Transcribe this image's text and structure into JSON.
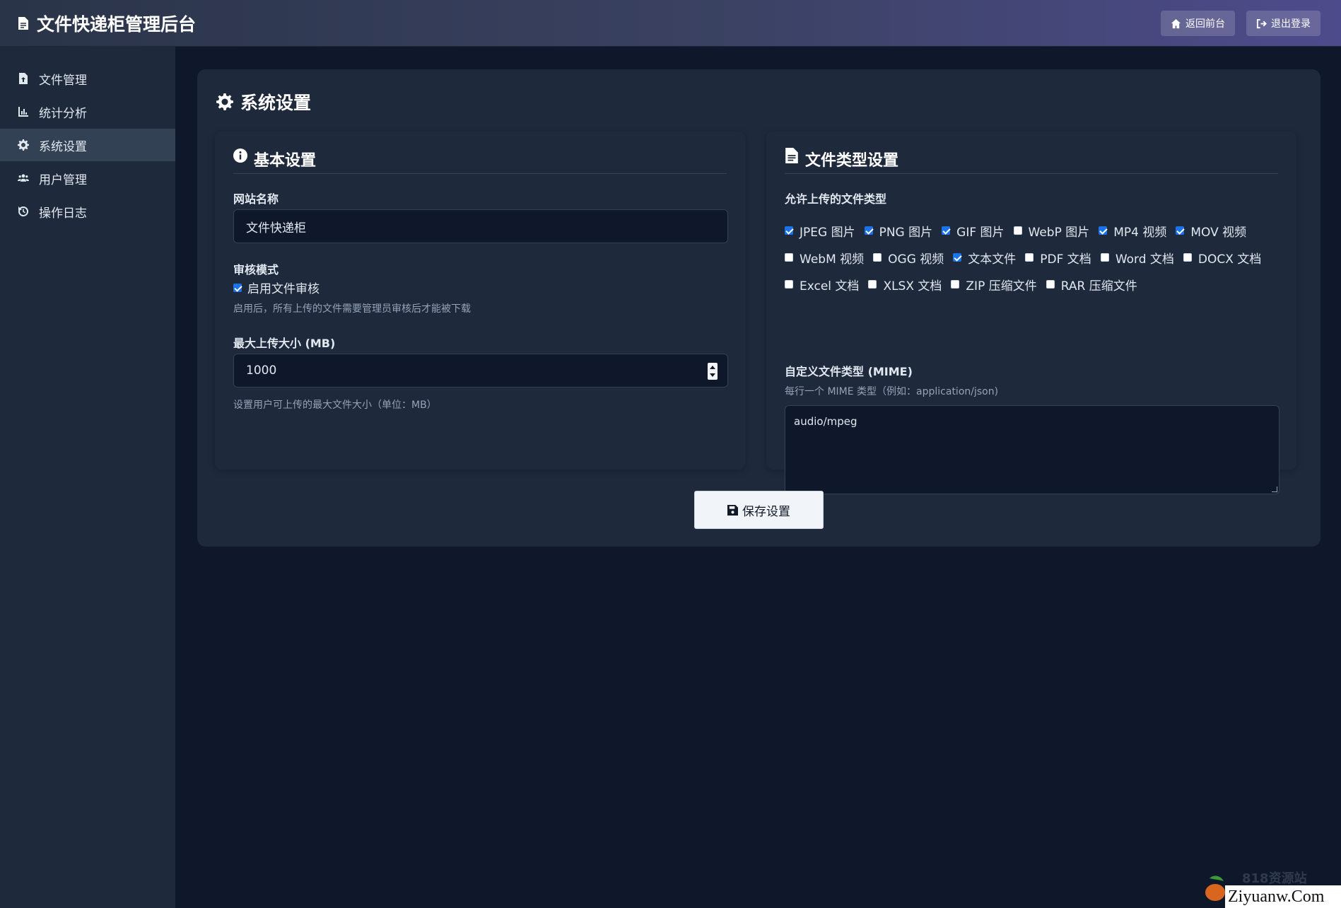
{
  "header": {
    "title": "文件快递柜管理后台",
    "back_label": "返回前台",
    "logout_label": "退出登录"
  },
  "sidebar": {
    "items": [
      {
        "label": "文件管理",
        "icon": "file-upload-icon"
      },
      {
        "label": "统计分析",
        "icon": "chart-icon"
      },
      {
        "label": "系统设置",
        "icon": "gear-icon",
        "active": true
      },
      {
        "label": "用户管理",
        "icon": "users-icon"
      },
      {
        "label": "操作日志",
        "icon": "history-icon"
      }
    ]
  },
  "main": {
    "title": "系统设置",
    "basic": {
      "heading": "基本设置",
      "site_name_label": "网站名称",
      "site_name_value": "文件快递柜",
      "review_label": "审核模式",
      "review_checkbox_label": "启用文件审核",
      "review_checked": true,
      "review_hint": "启用后，所有上传的文件需要管理员审核后才能被下载",
      "max_size_label": "最大上传大小 (MB)",
      "max_size_value": "1000",
      "max_size_hint": "设置用户可上传的最大文件大小（单位：MB）"
    },
    "filetypes": {
      "heading": "文件类型设置",
      "allowed_label": "允许上传的文件类型",
      "rows": [
        [
          {
            "label": "JPEG 图片",
            "checked": true
          },
          {
            "label": "PNG 图片",
            "checked": true
          },
          {
            "label": "GIF 图片",
            "checked": true
          },
          {
            "label": "WebP 图片",
            "checked": false
          },
          {
            "label": "MP4 视频",
            "checked": true
          },
          {
            "label": "MOV 视频",
            "checked": true
          }
        ],
        [
          {
            "label": "WebM 视频",
            "checked": false
          },
          {
            "label": "OGG 视频",
            "checked": false
          },
          {
            "label": "文本文件",
            "checked": true
          },
          {
            "label": "PDF 文档",
            "checked": false
          },
          {
            "label": "Word 文档",
            "checked": false
          },
          {
            "label": "DOCX 文档",
            "checked": false
          }
        ],
        [
          {
            "label": "Excel 文档",
            "checked": false
          },
          {
            "label": "XLSX 文档",
            "checked": false
          },
          {
            "label": "ZIP 压缩文件",
            "checked": false
          },
          {
            "label": "RAR 压缩文件",
            "checked": false
          }
        ]
      ],
      "mime_label": "自定义文件类型 (MIME)",
      "mime_hint": "每行一个 MIME 类型（例如：application/json)",
      "mime_value": "audio/mpeg"
    },
    "save_label": "保存设置"
  },
  "watermark": {
    "faint_text": "818资源站",
    "url_text": "Ziyuanw.Com"
  },
  "colors": {
    "background": "#0f172a",
    "panel": "#1e293b",
    "sidebar_active": "#334155",
    "checkbox_accent": "#1a73e8"
  }
}
